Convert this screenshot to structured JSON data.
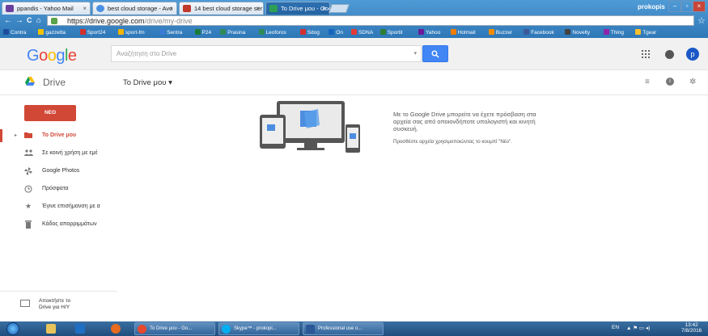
{
  "browser": {
    "tabs": [
      {
        "label": "ppandis - Yahoo Mail",
        "color": "#6b3fa0"
      },
      {
        "label": "best cloud storage - Avo",
        "color": "#4a90e2"
      },
      {
        "label": "14 best cloud storage ser",
        "color": "#c0392b"
      },
      {
        "label": "To Drive μου - Google Dr",
        "color": "#2f9e55"
      }
    ],
    "tab_close": "×",
    "user": "prokopis",
    "window_buttons": [
      "–",
      "▫",
      "×"
    ],
    "url_host": "https://drive.google.com",
    "url_path": "/drive/my-drive",
    "nav": {
      "back": "←",
      "forward": "→",
      "reload": "C",
      "home": "⌂"
    },
    "bookmark_star": "☆",
    "bookmarks": [
      {
        "label": "Contra",
        "color": "#1f4d9c"
      },
      {
        "label": "gazzetta",
        "color": "#f2c200"
      },
      {
        "label": "Sport24",
        "color": "#d32f2f"
      },
      {
        "label": "sport-fm",
        "color": "#f2b400"
      },
      {
        "label": "Sentra",
        "color": "#3a7bd5"
      },
      {
        "label": "P24",
        "color": "#1b7c3a"
      },
      {
        "label": "Prasina",
        "color": "#2e8b57"
      },
      {
        "label": "Leoforos",
        "color": "#2e8b57"
      },
      {
        "label": "Sdog",
        "color": "#d32f2f"
      },
      {
        "label": "On",
        "color": "#1565c0"
      },
      {
        "label": "SDNA",
        "color": "#e53935"
      },
      {
        "label": "Sportit",
        "color": "#2e7d32"
      },
      {
        "label": "Yahoo",
        "color": "#6a1b9a"
      },
      {
        "label": "Hotmail",
        "color": "#f57c00"
      },
      {
        "label": "Buzzer",
        "color": "#fb8c00"
      },
      {
        "label": "Facebook",
        "color": "#3b5998"
      },
      {
        "label": "Novelty",
        "color": "#424242"
      },
      {
        "label": "Thing",
        "color": "#8e24aa"
      },
      {
        "label": "Tgear",
        "color": "#fbc02d"
      }
    ]
  },
  "google": {
    "logo": [
      {
        "ch": "G",
        "color": "#4285f4"
      },
      {
        "ch": "o",
        "color": "#ea4335"
      },
      {
        "ch": "o",
        "color": "#fbbc05"
      },
      {
        "ch": "g",
        "color": "#4285f4"
      },
      {
        "ch": "l",
        "color": "#34a853"
      },
      {
        "ch": "e",
        "color": "#ea4335"
      }
    ],
    "search_placeholder": "Αναζήτηση στο Drive",
    "search_dropdown": "▾",
    "search_button_icon": "search-icon",
    "avatar_letter": "p"
  },
  "drive": {
    "title": "Drive",
    "breadcrumb": "To Drive μου ▾",
    "new_button": "ΝΕΟ",
    "nav": [
      {
        "label": "To Drive μου",
        "icon": "folder-icon",
        "selected": true
      },
      {
        "label": "Σε κοινή χρήση με εμέ",
        "icon": "people-icon",
        "selected": false
      },
      {
        "label": "Google Photos",
        "icon": "pinwheel-icon",
        "selected": false
      },
      {
        "label": "Πρόσφατα",
        "icon": "clock-icon",
        "selected": false
      },
      {
        "label": "Έγινε επισήμανση με α",
        "icon": "star-icon",
        "selected": false
      },
      {
        "label": "Κάδος απορριμμάτων",
        "icon": "trash-icon",
        "selected": false
      }
    ],
    "get_drive": [
      "Αποκτήστε το",
      "Drive για Η/Υ"
    ],
    "empty_message": "Με το Google Drive μπορείτε να έχετε πρόσβαση στα αρχεία σας από οποιονδήποτε υπολογιστή και κινητή συσκευή.",
    "empty_hint": "Προσθέστε αρχεία χρησιμοποιώντας το κουμπί \"Νέο\".",
    "caret": "▸"
  },
  "taskbar": {
    "items": [
      {
        "label": "To Drive μου - Go...",
        "color": "#e6492d"
      },
      {
        "label": "Skype™ - prokopi...",
        "color": "#00aff0"
      },
      {
        "label": "Professional use o...",
        "color": "#2b5797"
      }
    ],
    "lang": "EN",
    "time": "13:42",
    "date": "7/8/2016"
  }
}
